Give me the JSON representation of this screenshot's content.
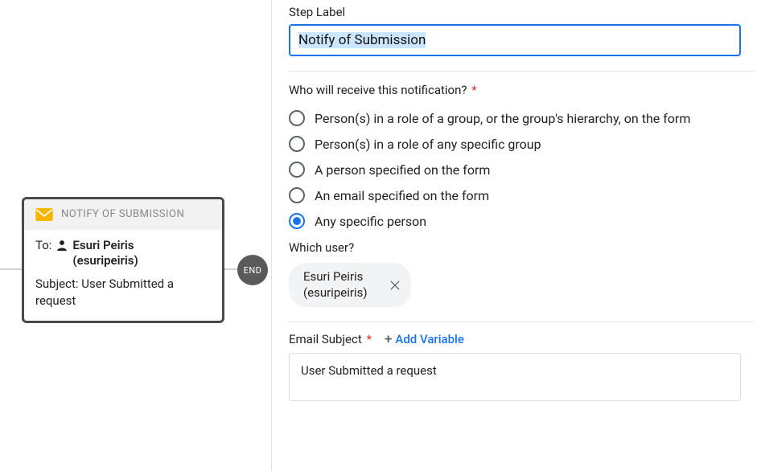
{
  "flow": {
    "node": {
      "title": "NOTIFY OF SUBMISSION",
      "toLabel": "To:",
      "toName": "Esuri Peiris",
      "toUsername": "(esuripeiris)",
      "subjectLabel": "Subject:",
      "subjectValue": "User Submitted a request"
    },
    "end": "END"
  },
  "panel": {
    "stepLabel": {
      "label": "Step Label",
      "value": "Notify of Submission"
    },
    "recipientQuestion": "Who will receive this notification?",
    "recipientOptions": [
      "Person(s) in a role of a group, or the group's hierarchy, on the form",
      "Person(s) in a role of any specific group",
      "A person specified on the form",
      "An email specified on the form",
      "Any specific person"
    ],
    "recipientSelectedIndex": 4,
    "whichUserLabel": "Which user?",
    "selectedUser": {
      "name": "Esuri Peiris",
      "username": "(esuripeiris)"
    },
    "emailSubject": {
      "label": "Email Subject",
      "addVariable": "Add Variable",
      "value": "User Submitted a request"
    }
  }
}
